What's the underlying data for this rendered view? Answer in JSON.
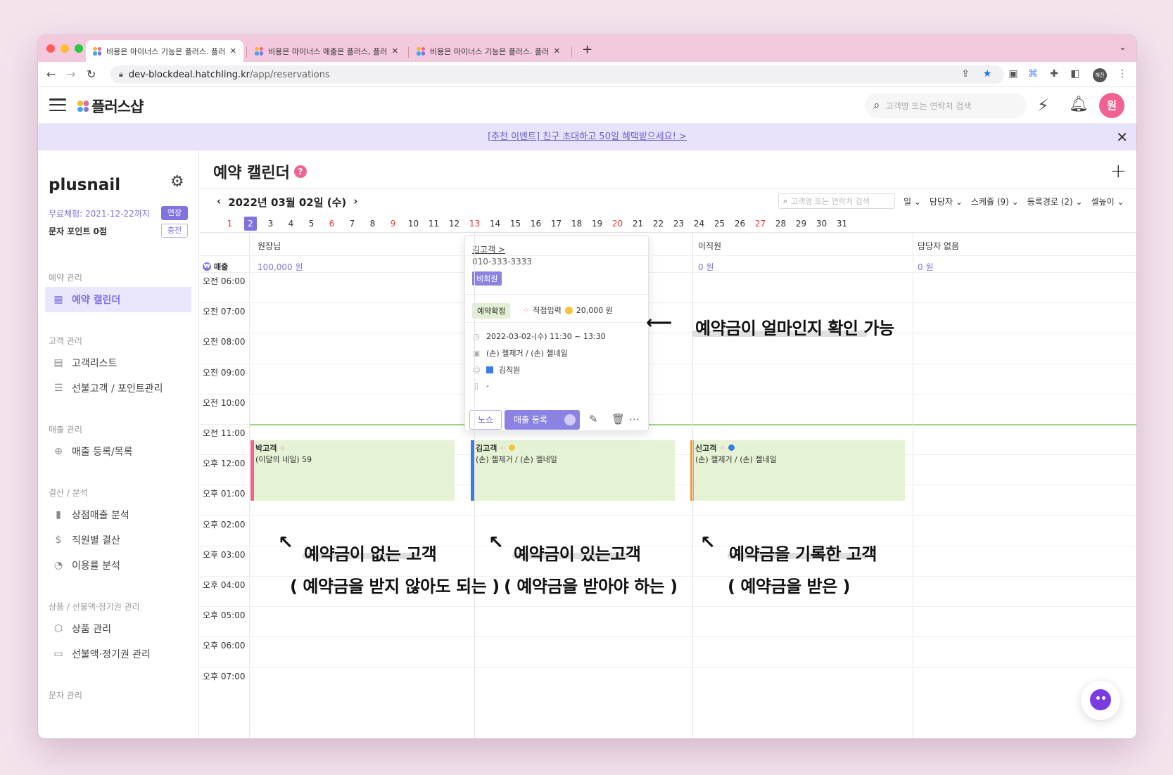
{
  "browser": {
    "tabs": [
      {
        "title": "비용은 마이너스 기능은 플러스. 플러스"
      },
      {
        "title": "비용은 마이너스 매출은 플러스, 플러스"
      },
      {
        "title": "비용은 마이너스 기능은 플러스. 플러스"
      }
    ],
    "url_domain": "dev-blockdeal.hatchling.kr",
    "url_path": "/app/reservations",
    "profile": "해진"
  },
  "header": {
    "logo": "플러스샵",
    "search_placeholder": "고객명 또는 연락처 검색",
    "avatar": "원"
  },
  "banner": {
    "text": "[추천 이벤트] 친구 초대하고 50일 혜택받으세요! >"
  },
  "sidebar": {
    "shop_name": "plusnail",
    "trial": "무료체험: 2021-12-22까지",
    "extend": "연장",
    "points": "문자 포인트 0점",
    "charge": "충전",
    "sections": [
      {
        "title": "예약 관리",
        "items": [
          {
            "label": "예약 캘린더",
            "icon": "calendar-icon"
          }
        ]
      },
      {
        "title": "고객 관리",
        "items": [
          {
            "label": "고객리스트",
            "icon": "document-icon"
          },
          {
            "label": "선불고객 / 포인트관리",
            "icon": "database-icon"
          }
        ]
      },
      {
        "title": "매출 관리",
        "items": [
          {
            "label": "매출 등록/목록",
            "icon": "add-file-icon"
          }
        ]
      },
      {
        "title": "결산 / 분석",
        "items": [
          {
            "label": "상점매출 분석",
            "icon": "bar-chart-icon"
          },
          {
            "label": "직원별 결산",
            "icon": "dollar-icon"
          },
          {
            "label": "이용률 분석",
            "icon": "pie-icon"
          }
        ]
      },
      {
        "title": "상품 / 선불액·정기권 관리",
        "items": [
          {
            "label": "상품 관리",
            "icon": "box-icon"
          },
          {
            "label": "선불액·정기권 관리",
            "icon": "ticket-icon"
          }
        ]
      },
      {
        "title": "문자 관리",
        "items": []
      }
    ]
  },
  "calendar": {
    "title": "예약 캘린더",
    "date": "2022년 03월 02일 (수)",
    "search_placeholder": "고객명 또는 연락처 검색",
    "filters": [
      "일",
      "담당자",
      "스케쥴 (9)",
      "등록경로 (2)",
      "셀높이"
    ],
    "days": [
      "1",
      "2",
      "3",
      "4",
      "5",
      "6",
      "7",
      "8",
      "9",
      "10",
      "11",
      "12",
      "13",
      "14",
      "15",
      "16",
      "17",
      "18",
      "19",
      "20",
      "21",
      "22",
      "23",
      "24",
      "25",
      "26",
      "27",
      "28",
      "29",
      "30",
      "31"
    ],
    "red_days": [
      "1",
      "6",
      "9",
      "13",
      "20",
      "27"
    ],
    "selected_day": "2",
    "sales_label": "매출",
    "columns": [
      {
        "name": "원장님",
        "sales": "100,000 원"
      },
      {
        "name": "",
        "sales": ""
      },
      {
        "name": "이직원",
        "sales": "0 원"
      },
      {
        "name": "담당자 없음",
        "sales": "0 원"
      }
    ],
    "times": [
      "오전 06:00",
      "오전 07:00",
      "오전 08:00",
      "오전 09:00",
      "오전 10:00",
      "오전 11:00",
      "오후 12:00",
      "오후 01:00",
      "오후 02:00",
      "오후 03:00",
      "오후 04:00",
      "오후 05:00",
      "오후 06:00",
      "오후 07:00"
    ],
    "appointments": [
      {
        "name": "박고객",
        "detail": "(이달의 네일) 59",
        "bar_color": "#f06292"
      },
      {
        "name": "김고객",
        "detail": "(손) 젤제거 / (손) 젤네일",
        "bar_color": "#3b7de0"
      },
      {
        "name": "신고객",
        "detail": "(손) 젤제거 / (손) 젤네일",
        "bar_color": "#f59a3a"
      }
    ]
  },
  "popup": {
    "name": "김고객 >",
    "phone": "010-333-3333",
    "badge": "비회원",
    "status": "예약확정",
    "source": "직접입력",
    "deposit": "20,000 원",
    "datetime": "2022-03-02-(수) 11:30 ~ 13:30",
    "service": "(손) 젤제거 / (손) 젤네일",
    "staff": "김직원",
    "memo": "-",
    "noshow": "노쇼",
    "register_sale": "매출 등록"
  },
  "annotations": {
    "deposit_note": "예약금이 얼마인지 확인 가능",
    "no_deposit": "예약금이 없는 고객",
    "no_deposit_sub": "( 예약금을 받지 않아도 되는 )",
    "has_deposit": "예약금이 있는고객",
    "has_deposit_sub": "( 예약금을 받아야 하는 )",
    "recorded": "예약금을 기록한 고객",
    "recorded_sub": "( 예약금을 받은 )"
  }
}
